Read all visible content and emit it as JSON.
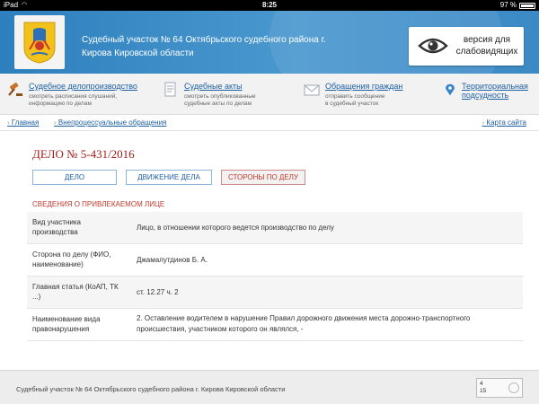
{
  "status_bar": {
    "carrier": "iPad",
    "time": "8:25",
    "battery": "97 %"
  },
  "header": {
    "court_name": "Судебный участок № 64 Октябрьского судебного района г. Кирова Кировской области",
    "vision_button": "версия для слабовидящих"
  },
  "nav": {
    "items": [
      {
        "title": "Судебное делопроизводство",
        "subtitle1": "смотреть расписания слушаний,",
        "subtitle2": "информацию по делам"
      },
      {
        "title": "Судебные акты",
        "subtitle1": "смотреть опубликованные",
        "subtitle2": "судебные акты по делам"
      },
      {
        "title": "Обращения граждан",
        "subtitle1": "отправить сообщение",
        "subtitle2": "в судебный участок"
      },
      {
        "title": "Территориальная",
        "title2": "подсудность"
      }
    ]
  },
  "breadcrumbs": {
    "home": "Главная",
    "current": "Внепроцессуальные обращения",
    "map": "Карта сайта"
  },
  "case": {
    "title": "ДЕЛО № 5-431/2016",
    "tabs": [
      "ДЕЛО",
      "ДВИЖЕНИЕ ДЕЛА",
      "СТОРОНЫ ПО ДЕЛУ"
    ],
    "section_title": "СВЕДЕНИЯ О ПРИВЛЕКАЕМОМ ЛИЦЕ",
    "rows": [
      {
        "label": "Вид участника производства",
        "value": "Лицо, в отношении которого ведется производство по делу"
      },
      {
        "label": "Сторона по делу (ФИО, наименование)",
        "value": "Джамалутдинов Б. А."
      },
      {
        "label": "Главная статья (КоАП, ТК ...)",
        "value": "ст. 12.27 ч. 2"
      },
      {
        "label": "Наименование вида правонарушения",
        "value": "2. Оставление водителем в нарушение Правил дорожного движения места дорожно-транспортного происшествия, участником которого он являлся, -"
      }
    ]
  },
  "footer": {
    "text": "Судебный участок № 64 Октябрьского судебного района г. Кирова Кировской области",
    "counter1": "4",
    "counter2": "15"
  },
  "colors": {
    "header_blue": "#2d7fbd",
    "link_blue": "#1d5fa3",
    "accent_red": "#c0392b"
  }
}
